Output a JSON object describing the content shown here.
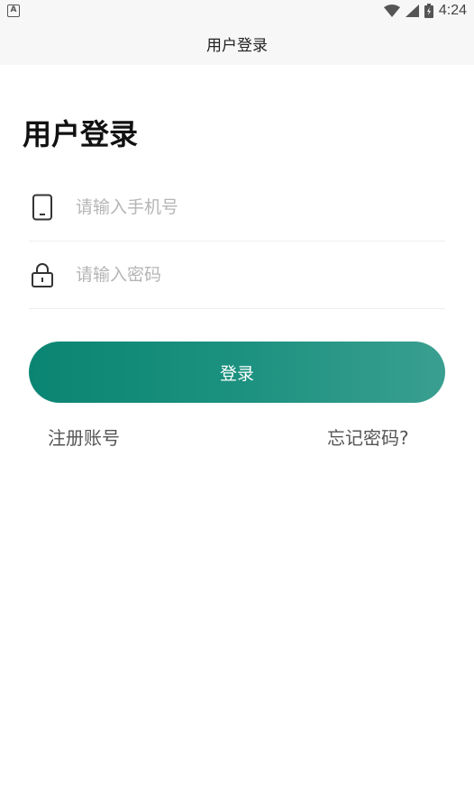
{
  "status_bar": {
    "notification_letter": "A",
    "time": "4:24",
    "icons": [
      "wifi-icon",
      "cell-signal-icon",
      "battery-charging-icon"
    ]
  },
  "app_bar": {
    "title": "用户登录"
  },
  "page": {
    "heading": "用户登录"
  },
  "form": {
    "phone": {
      "icon": "mobile-phone-icon",
      "placeholder": "请输入手机号",
      "value": ""
    },
    "password": {
      "icon": "lock-icon",
      "placeholder": "请输入密码",
      "value": ""
    },
    "login_label": "登录"
  },
  "links": {
    "register": "注册账号",
    "forgot_password": "忘记密码?"
  },
  "colors": {
    "accent_start": "#0b8573",
    "accent_end": "#3a9f90",
    "placeholder": "#b5b5b5",
    "divider": "#eeeeee"
  }
}
